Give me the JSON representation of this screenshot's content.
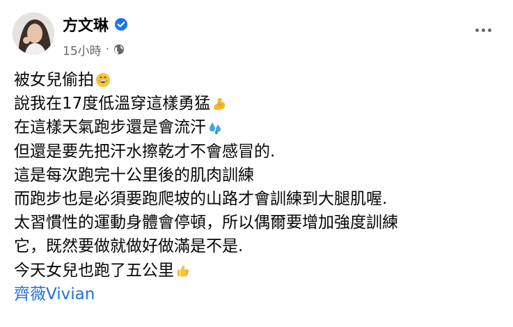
{
  "post": {
    "author": "方文琳",
    "timestamp": "15小時",
    "meta_separator": "·",
    "privacy_icon": "globe-icon",
    "verified_icon": "verified-badge-icon",
    "more_icon": "more-options-icon",
    "lines": [
      {
        "text": "被女兒偷拍",
        "emoji": "grinning-face-emoji"
      },
      {
        "text": "說我在17度低溫穿這樣勇猛",
        "emoji": "flexed-biceps-emoji"
      },
      {
        "text": "在這樣天氣跑步還是會流汗",
        "emoji": "sweat-droplets-emoji"
      },
      {
        "text": "但還是要先把汗水擦乾才不會感冒的."
      },
      {
        "text": "這是每次跑完十公里後的肌肉訓練"
      },
      {
        "text": "而跑步也是必須要跑爬坡的山路才會訓練到大腿肌喔."
      },
      {
        "text": "太習慣性的運動身體會停頓，所以偶爾要增加強度訓練"
      },
      {
        "text": "它，既然要做就做好做滿是不是."
      },
      {
        "text": "今天女兒也跑了五公里",
        "emoji": "thumbs-up-emoji"
      }
    ],
    "mention": "齊薇Vivian"
  },
  "colors": {
    "text": "#050505",
    "secondary": "#65676b",
    "link": "#216fdb",
    "verified": "#1877f2",
    "emoji_yellow": "#f7c637"
  }
}
